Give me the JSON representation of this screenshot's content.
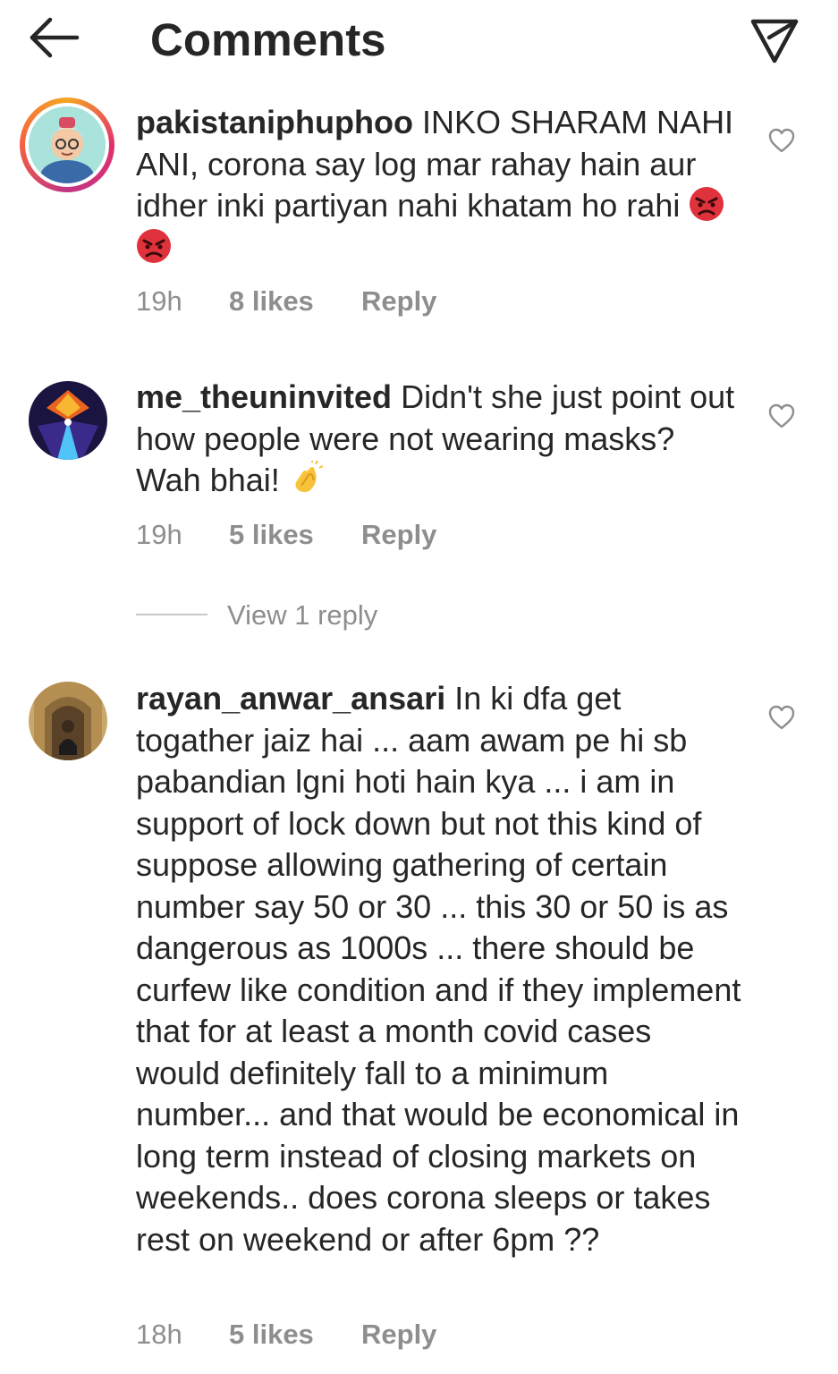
{
  "header": {
    "title": "Comments"
  },
  "comments": [
    {
      "username": "pakistaniphuphoo",
      "text": "INKO SHARAM NAHI ANI, corona say log mar rahay hain aur idher inki partiyan nahi khatam ho rahi",
      "emojis": [
        "angry-face",
        "angry-face"
      ],
      "time": "19h",
      "likes": "8 likes",
      "reply_label": "Reply"
    },
    {
      "username": "me_theuninvited",
      "text": "Didn't she just point out how people were not wearing masks? Wah bhai!",
      "emojis": [
        "clapping-hands"
      ],
      "time": "19h",
      "likes": "5 likes",
      "reply_label": "Reply",
      "view_replies": "View 1 reply"
    },
    {
      "username": "rayan_anwar_ansari",
      "text": "In ki dfa get togather jaiz hai ... aam awam pe hi sb pabandian lgni hoti hain kya ... i am in support of lock down but not this kind of suppose allowing gathering of certain number say 50 or 30 ... this 30 or 50 is as dangerous as 1000s ... there should be curfew like condition and if they implement that for at least a month covid cases would definitely fall to a minimum number... and that would be economical in long term instead of closing markets on weekends.. does corona sleeps or takes rest on weekend or after 6pm ??",
      "emojis": [],
      "time": "18h",
      "likes": "5 likes",
      "reply_label": "Reply"
    }
  ],
  "colors": {
    "text": "#262626",
    "secondary": "#8e8e8e",
    "angry_emoji": "#e0323c"
  }
}
